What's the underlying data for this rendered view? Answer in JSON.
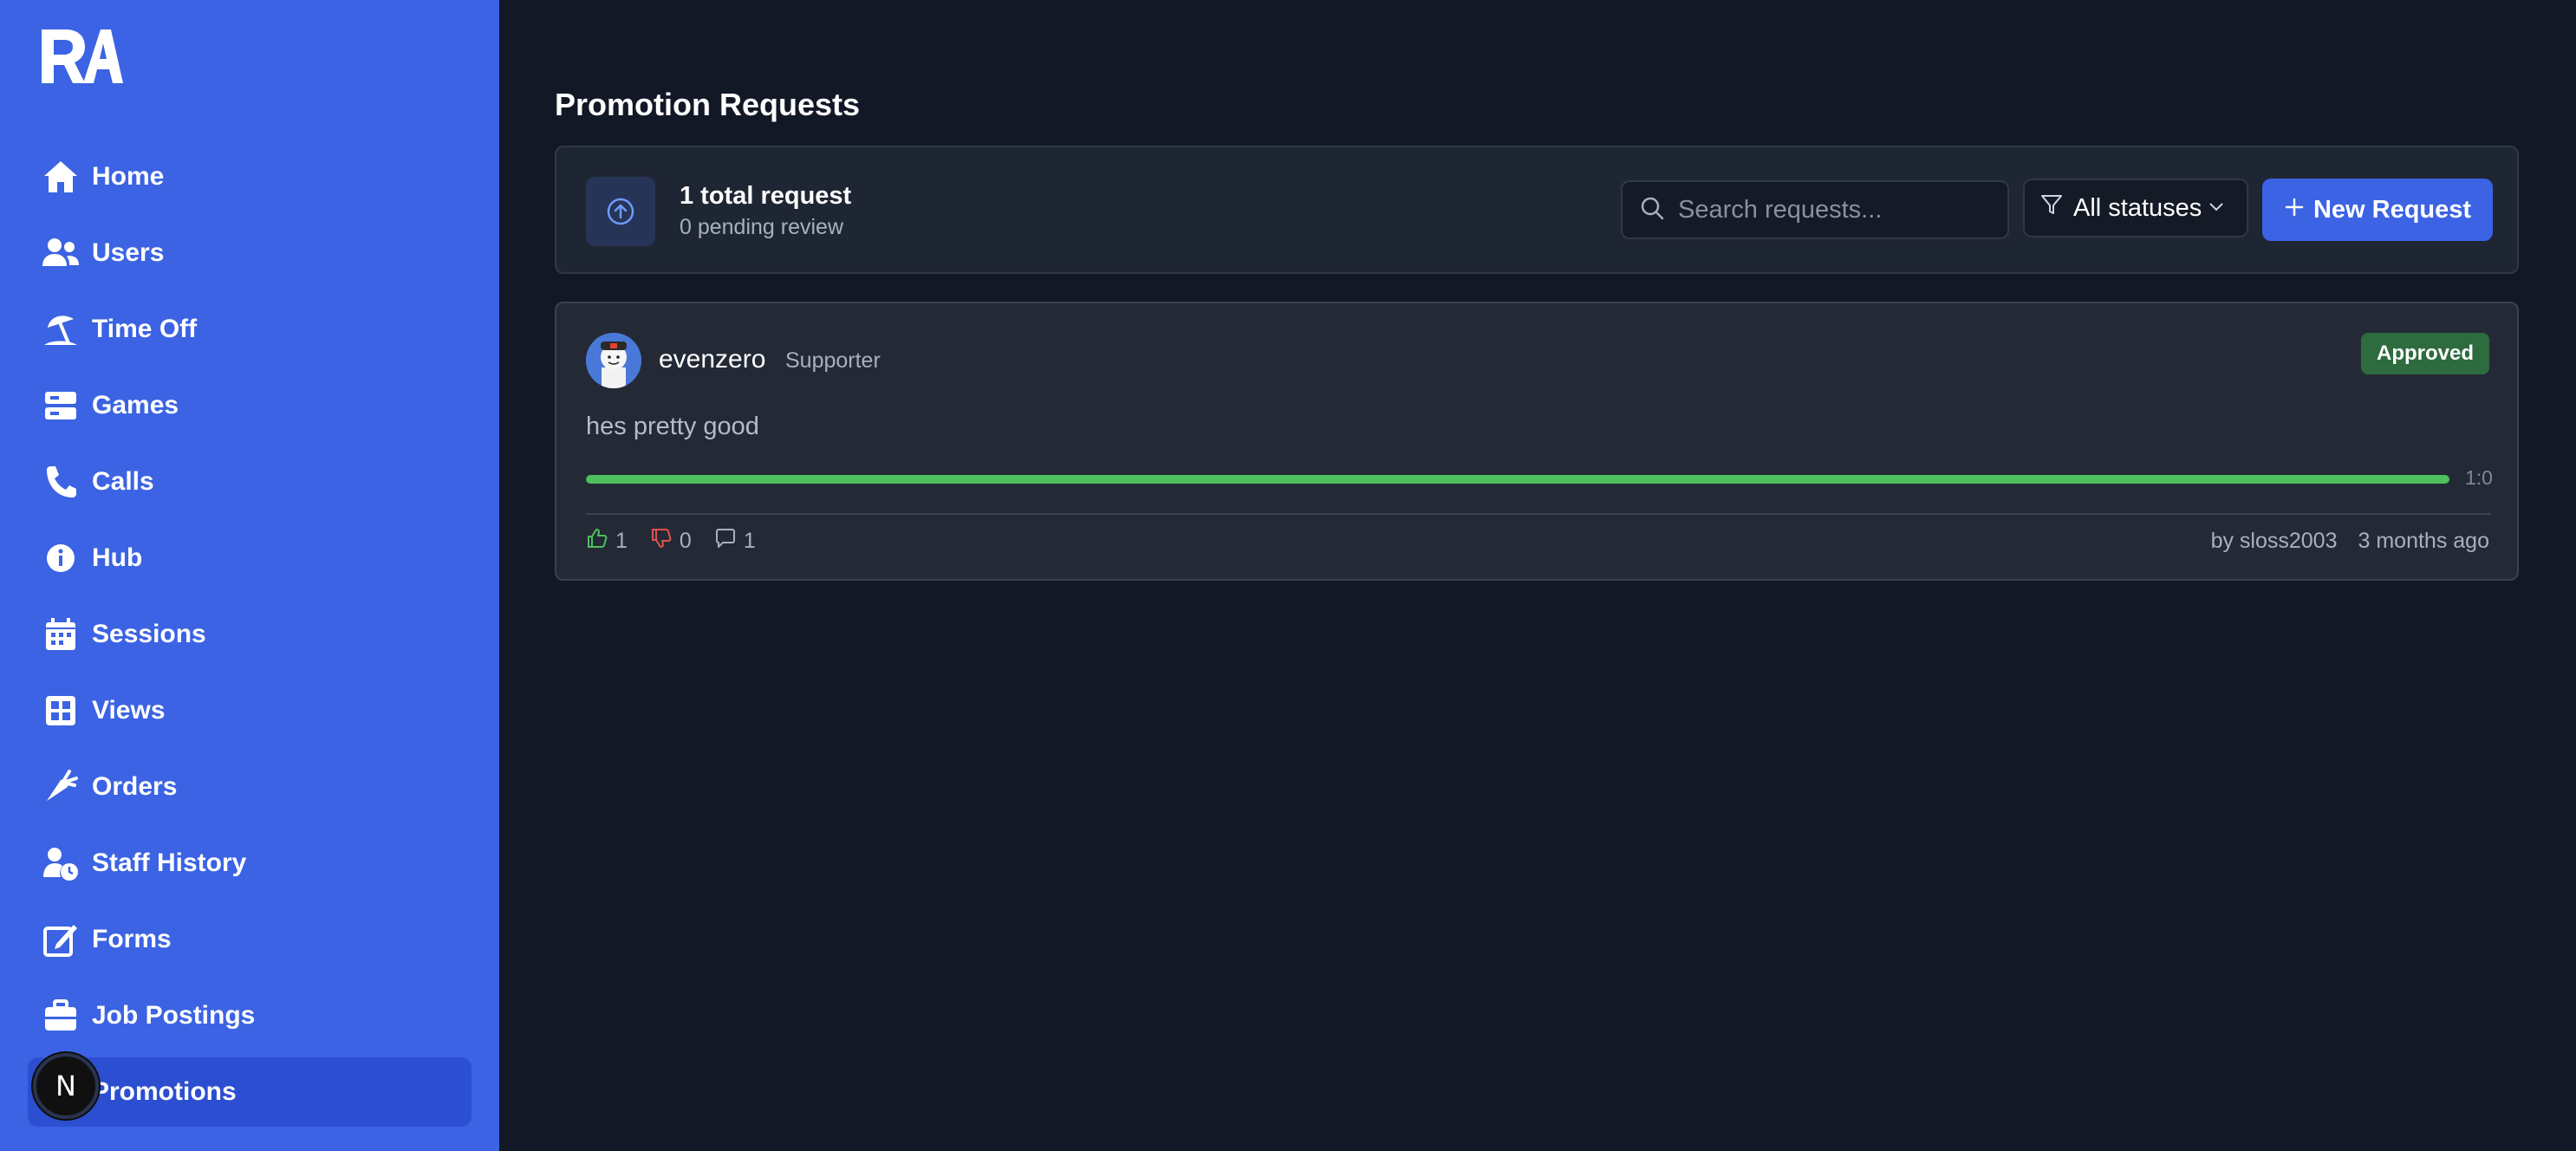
{
  "sidebar": {
    "logo_text": "RA",
    "items": [
      {
        "label": "Home",
        "icon": "home-icon"
      },
      {
        "label": "Users",
        "icon": "users-icon"
      },
      {
        "label": "Time Off",
        "icon": "umbrella-beach-icon"
      },
      {
        "label": "Games",
        "icon": "server-icon"
      },
      {
        "label": "Calls",
        "icon": "phone-icon"
      },
      {
        "label": "Hub",
        "icon": "info-icon"
      },
      {
        "label": "Sessions",
        "icon": "calendar-icon"
      },
      {
        "label": "Views",
        "icon": "grid-icon"
      },
      {
        "label": "Orders",
        "icon": "carrot-icon"
      },
      {
        "label": "Staff History",
        "icon": "user-clock-icon"
      },
      {
        "label": "Forms",
        "icon": "edit-icon"
      },
      {
        "label": "Job Postings",
        "icon": "briefcase-icon"
      },
      {
        "label": "Promotions",
        "icon": "arrow-up-icon"
      }
    ],
    "active_item": "Promotions",
    "badge_letter": "N"
  },
  "page": {
    "title": "Promotion Requests"
  },
  "summary": {
    "total": "1 total request",
    "pending": "0 pending review"
  },
  "search": {
    "placeholder": "Search requests..."
  },
  "filter": {
    "selected": "All statuses"
  },
  "new_button": {
    "label": "New Request"
  },
  "requests": [
    {
      "username": "evenzero",
      "role": "Supporter",
      "status": "Approved",
      "reason": "hes pretty good",
      "ratio": "1:0",
      "approval_fraction": 1.0,
      "upvotes": "1",
      "downvotes": "0",
      "comments": "1",
      "author": "by sloss2003",
      "time": "3 months ago"
    }
  ],
  "colors": {
    "sidebar_bg": "#3b63e3",
    "page_bg": "#121826",
    "card_bg": "#232a36",
    "accent": "#3b63e3",
    "approved": "#2e6b3e",
    "progress": "#4ec05d",
    "downvote": "#e05252"
  }
}
